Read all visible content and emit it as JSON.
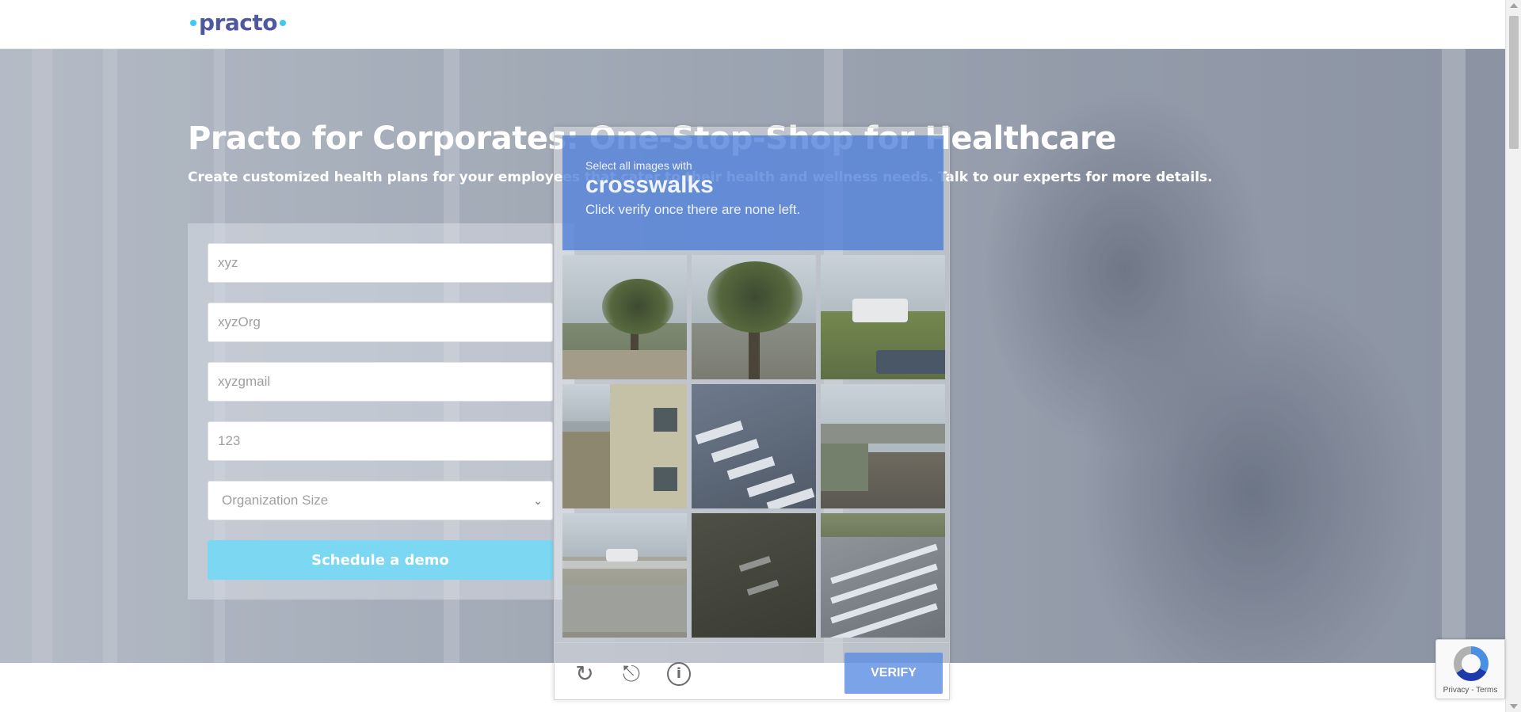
{
  "header": {
    "logo_text": "practo"
  },
  "hero": {
    "title": "Practo for Corporates: One-Stop-Shop for Healthcare",
    "subtitle": "Create customized health plans for your employees that cater to their health and wellness needs. Talk to our experts for more details."
  },
  "form": {
    "name_value": "xyz",
    "org_value": "xyzOrg",
    "email_value": "xyzgmail",
    "phone_value": "123",
    "org_size_selected": "Organization Size",
    "submit_label": "Schedule a demo"
  },
  "captcha": {
    "instruction": "Select all images with",
    "target": "crosswalks",
    "sub_instruction": "Click verify once there are none left.",
    "verify_label": "VERIFY",
    "icons": [
      "reload-icon",
      "audio-icon",
      "info-icon"
    ],
    "accent_color": "#4a78d7"
  },
  "recaptcha_badge": {
    "links": "Privacy - Terms"
  },
  "colors": {
    "brand_blue": "#28328c",
    "brand_cyan": "#14bef0",
    "demo_button": "#5ecff0"
  }
}
